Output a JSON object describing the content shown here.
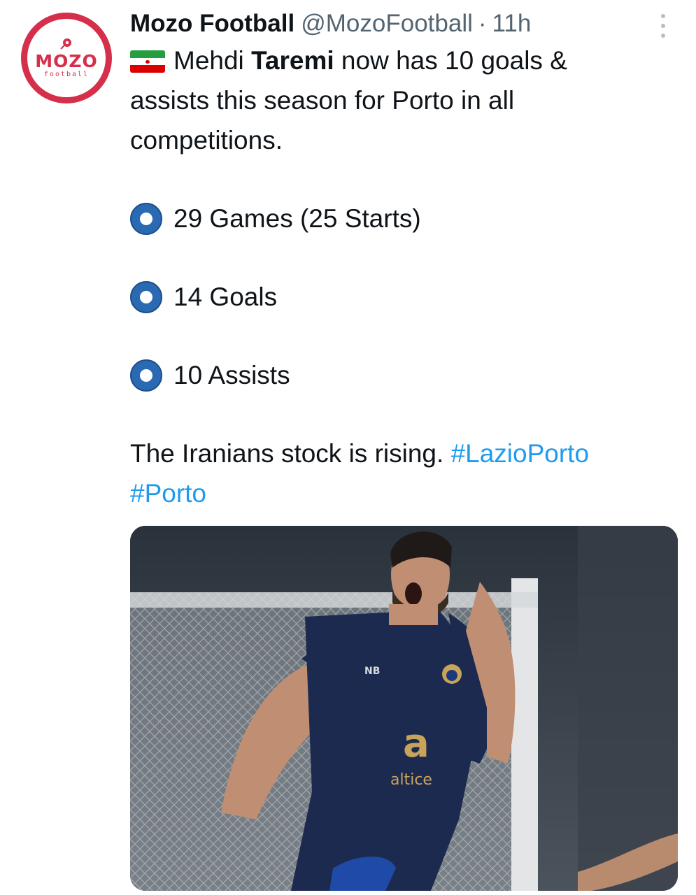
{
  "tweet": {
    "account": {
      "name": "Mozo Football",
      "handle": "@MozoFootball",
      "separator": "·",
      "time": "11h",
      "avatar": {
        "logo_main": "MOZO",
        "logo_sub": "football"
      }
    },
    "intro_name_first": "Mehdi ",
    "intro_name_last": "Taremi",
    "intro_rest_line1": " now has 10 goals &",
    "intro_line2": "assists this season for Porto in all",
    "intro_line3": "competitions.",
    "stats": [
      "29 Games (25 Starts)",
      "14 Goals",
      "10 Assists"
    ],
    "closing_text": "The Iranians stock is rising. ",
    "hashtags": [
      "#LazioPorto",
      "#Porto"
    ],
    "media": {
      "jersey_sponsor": "altice",
      "jersey_brand": "NB"
    }
  },
  "colors": {
    "avatar_ring": "#d62f4b",
    "hashtag": "#1d9bf0",
    "bullet": "#2a6ab3",
    "jersey": "#1c2a4f"
  },
  "icons": [
    "iran-flag-icon",
    "blue-circle-bullet-icon",
    "more-options-icon",
    "football-icon"
  ]
}
